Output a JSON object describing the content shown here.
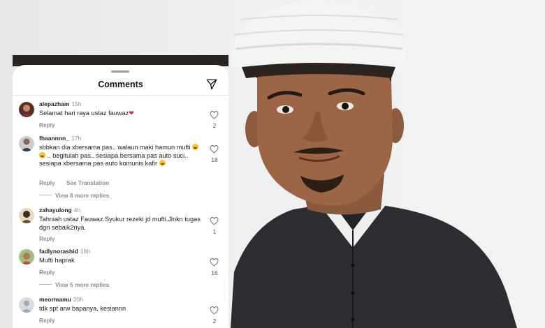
{
  "sheet": {
    "title": "Comments",
    "icons": {
      "share": "paper-plane-icon"
    }
  },
  "comments": [
    {
      "username": "alepazham",
      "time": "15h",
      "text": "Selamat hari raya ustaz fauwaz",
      "emoji": "red-heart",
      "reply_label": "Reply",
      "likes": "2"
    },
    {
      "username": "fhaannnn_",
      "time": "17h",
      "text_parts": [
        "sbbkan dia xbersama pas.. walaun maki hamun mufti ",
        " .. begitulah pas.. sesiapa bersama pas auto suci.. sesiapa xbersama pas auto komunis kafir "
      ],
      "reply_label": "Reply",
      "translate_label": "See Translation",
      "likes": "18",
      "view_replies": "View 8 more replies"
    },
    {
      "username": "zahayulong",
      "time": "4h",
      "text": "Tahniah ustaz Fauwaz.Syukur rezeki jd mufti.Jlnkn tugas dgn sebaik2nya.",
      "reply_label": "Reply",
      "likes": "1"
    },
    {
      "username": "fadlynorashid",
      "time": "18h",
      "text": "Mufti haprak",
      "reply_label": "Reply",
      "likes": "16",
      "view_replies": "View 5 more replies"
    },
    {
      "username": "meormamu",
      "time": "20h",
      "text": "tdk spt arw bapanya, kesiannn",
      "reply_label": "Reply",
      "likes": "2"
    }
  ],
  "colors": {
    "heart_red": "#e0243c",
    "muted_text": "#8e8e8e",
    "sheet_bg": "#ffffff"
  }
}
